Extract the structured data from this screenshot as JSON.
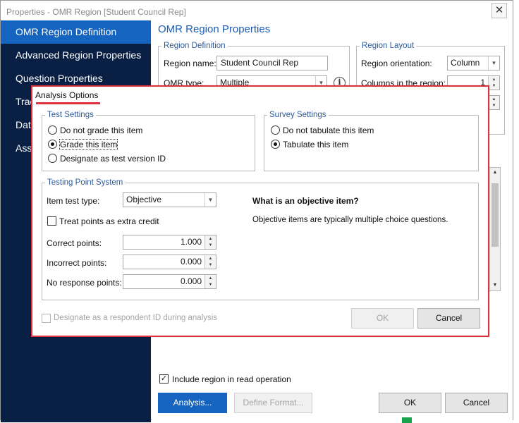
{
  "window": {
    "title": "Properties - OMR Region [Student Council Rep]",
    "close_glyph": "✕"
  },
  "sidebar": {
    "items": [
      {
        "label": "OMR Region Definition"
      },
      {
        "label": "Advanced Region Properties"
      },
      {
        "label": "Question Properties"
      },
      {
        "label": "Trac"
      },
      {
        "label": "Data"
      },
      {
        "label": "Asso"
      }
    ]
  },
  "main": {
    "title": "OMR Region Properties",
    "region_definition": {
      "legend": "Region Definition",
      "name_label": "Region name:",
      "name_value": "Student Council Rep",
      "type_label": "OMR type:",
      "type_value": "Multiple"
    },
    "region_layout": {
      "legend": "Region Layout",
      "orientation_label": "Region orientation:",
      "orientation_value": "Column",
      "columns_label": "Columns in the region:",
      "columns_value": "1"
    },
    "include_label": "Include region in read operation",
    "buttons": {
      "analysis": "Analysis...",
      "define_format": "Define Format...",
      "ok": "OK",
      "cancel": "Cancel"
    }
  },
  "dialog": {
    "title": "Analysis Options",
    "test_settings": {
      "legend": "Test Settings",
      "options": [
        "Do not grade this item",
        "Grade this item",
        "Designate as test version ID"
      ],
      "selected_index": 1
    },
    "survey_settings": {
      "legend": "Survey Settings",
      "options": [
        "Do not tabulate this item",
        "Tabulate this item"
      ],
      "selected_index": 1
    },
    "testing_point_system": {
      "legend": "Testing Point System",
      "item_test_type_label": "Item test type:",
      "item_test_type_value": "Objective",
      "extra_credit_label": "Treat points as extra credit",
      "correct_label": "Correct points:",
      "correct_value": "1.000",
      "incorrect_label": "Incorrect points:",
      "incorrect_value": "0.000",
      "no_response_label": "No response points:",
      "no_response_value": "0.000",
      "info_heading": "What is an objective item?",
      "info_text": "Objective items are typically multiple choice questions."
    },
    "respondent_id_label": "Designate as a respondent ID during analysis",
    "ok_label": "OK",
    "cancel_label": "Cancel"
  },
  "colors": {
    "sidebar_bg": "#0a1f44",
    "accent_blue": "#1565c0",
    "highlight_red": "#e0303c"
  }
}
